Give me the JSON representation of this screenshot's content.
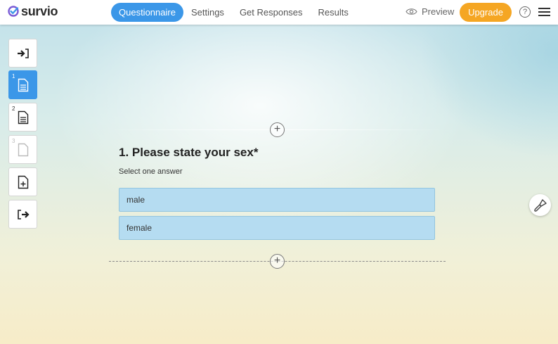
{
  "brand": {
    "name": "survio",
    "accent": "#3b97e8",
    "upgrade_color": "#f5a623"
  },
  "nav": {
    "tabs": [
      {
        "label": "Questionnaire",
        "active": true
      },
      {
        "label": "Settings"
      },
      {
        "label": "Get Responses"
      },
      {
        "label": "Results"
      }
    ],
    "preview_label": "Preview",
    "upgrade_label": "Upgrade",
    "help_label": "?"
  },
  "sidebar": {
    "items": [
      {
        "icon": "enter-icon"
      },
      {
        "icon": "page-icon",
        "number": "1",
        "active": true
      },
      {
        "icon": "page-icon",
        "number": "2"
      },
      {
        "icon": "blank-page-icon",
        "number": "3"
      },
      {
        "icon": "add-page-icon"
      },
      {
        "icon": "exit-icon"
      }
    ]
  },
  "question": {
    "title": "1. Please state your sex*",
    "instruction": "Select one answer",
    "answers": [
      "male",
      "female"
    ]
  }
}
